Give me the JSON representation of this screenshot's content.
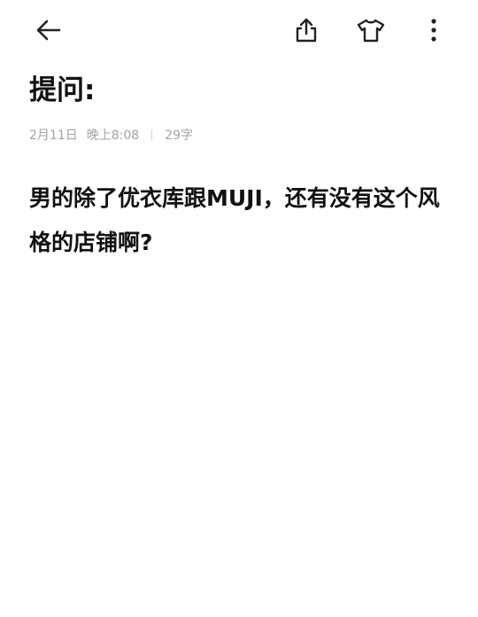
{
  "note": {
    "title": "提问:",
    "date": "2月11日",
    "time": "晚上8:08",
    "word_count": "29字",
    "body": "男的除了优衣库跟MUJI，还有没有这个风格的店铺啊?"
  },
  "toolbar": {
    "back_icon": "arrow-left-icon",
    "share_icon": "share-icon",
    "skin_icon": "shirt-icon",
    "more_icon": "more-vertical-icon"
  },
  "colors": {
    "text": "#111111",
    "meta": "#a3a3a3",
    "background": "#ffffff"
  }
}
